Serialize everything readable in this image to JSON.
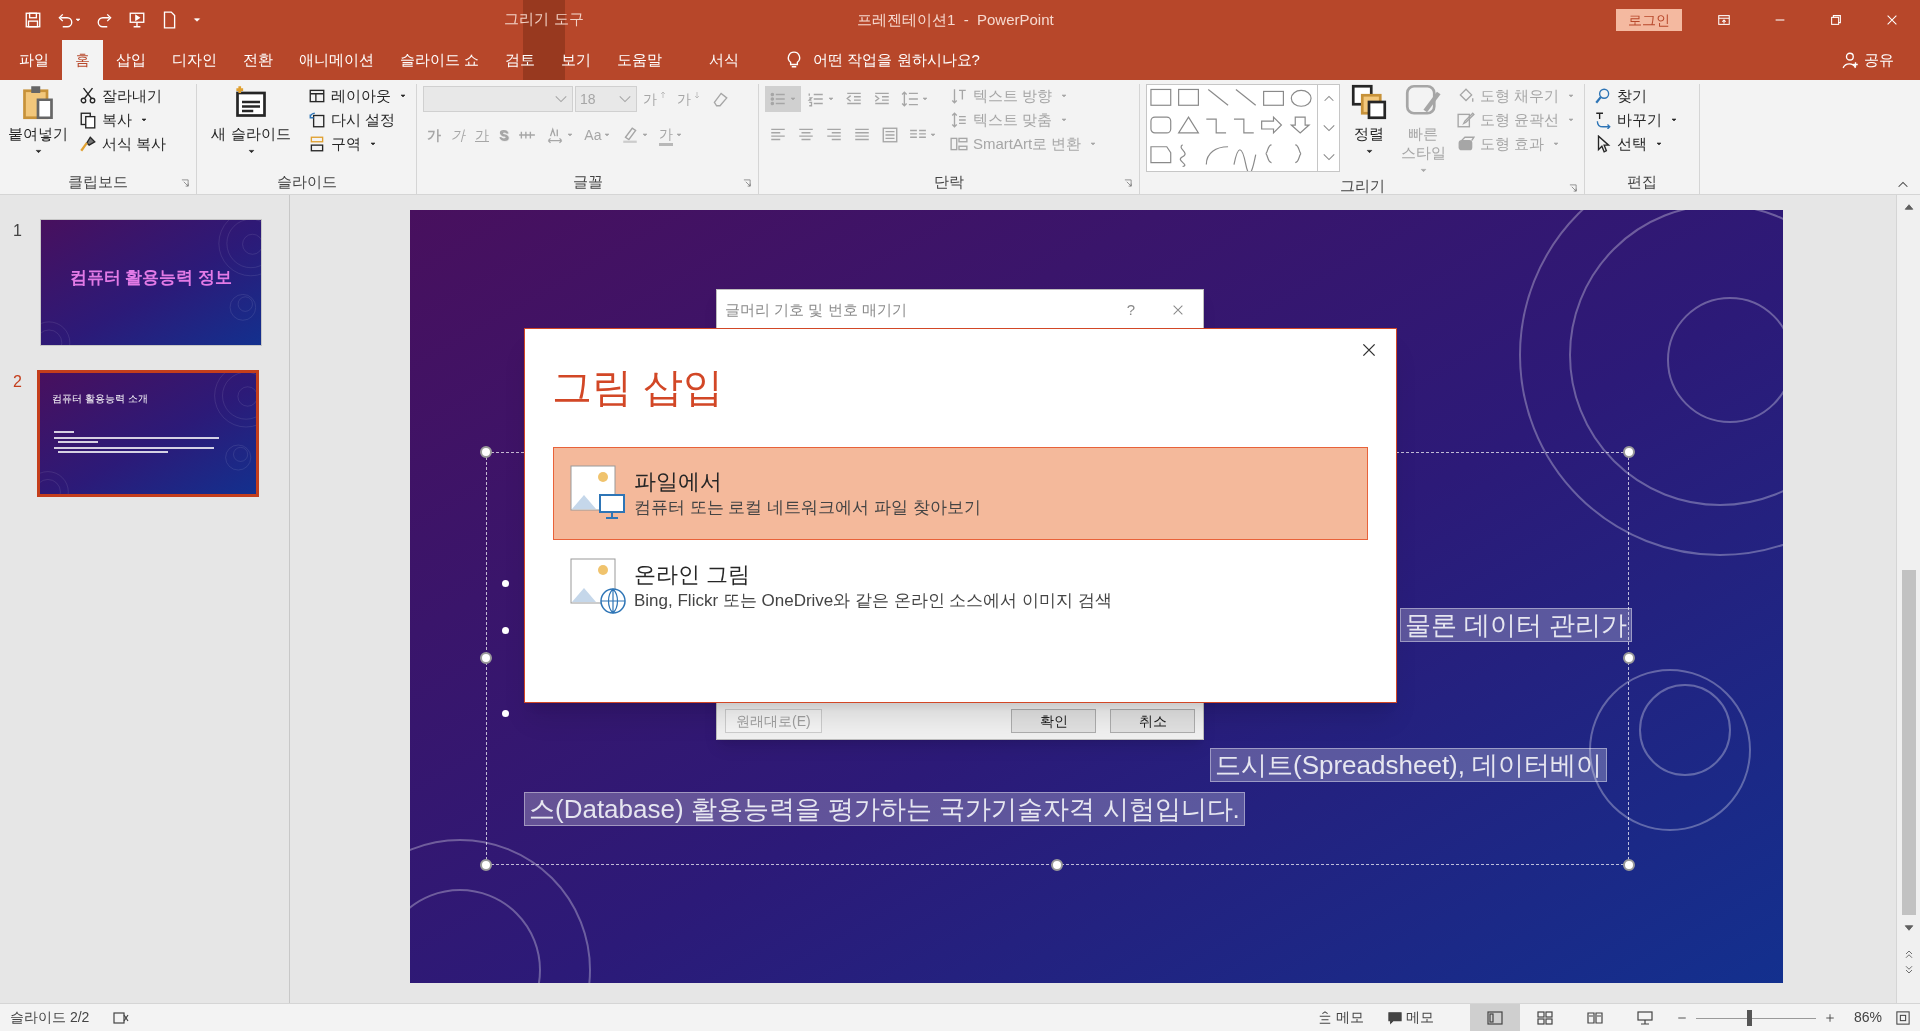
{
  "title_bar": {
    "contextual_group": "그리기 도구",
    "title": "프레젠테이션1  -  PowerPoint",
    "login_button": "로그인"
  },
  "tabs": [
    {
      "label": "파일",
      "kind": "normal",
      "selected": false
    },
    {
      "label": "홈",
      "kind": "normal",
      "selected": true
    },
    {
      "label": "삽입",
      "kind": "normal",
      "selected": false
    },
    {
      "label": "디자인",
      "kind": "normal",
      "selected": false
    },
    {
      "label": "전환",
      "kind": "normal",
      "selected": false
    },
    {
      "label": "애니메이션",
      "kind": "normal",
      "selected": false
    },
    {
      "label": "슬라이드 쇼",
      "kind": "normal",
      "selected": false
    },
    {
      "label": "검토",
      "kind": "normal",
      "selected": false
    },
    {
      "label": "보기",
      "kind": "normal",
      "selected": false
    },
    {
      "label": "도움말",
      "kind": "normal",
      "selected": false
    },
    {
      "label": "서식",
      "kind": "contextual",
      "selected": false
    }
  ],
  "tell_me": "어떤 작업을 원하시나요?",
  "share_button": "공유",
  "ribbon_groups": [
    {
      "label": "클립보드",
      "launcher": true,
      "items": [
        {
          "kind": "large",
          "label": "붙여넣기",
          "dropdown": true,
          "disabled": false
        },
        {
          "kind": "small",
          "label": "잘라내기",
          "disabled": false
        },
        {
          "kind": "small",
          "label": "복사",
          "dropdown": true,
          "disabled": false
        },
        {
          "kind": "small",
          "label": "서식 복사",
          "disabled": false
        }
      ]
    },
    {
      "label": "슬라이드",
      "items": [
        {
          "kind": "large",
          "label": "새 슬라이드",
          "dropdown": true,
          "disabled": false
        },
        {
          "kind": "small",
          "label": "레이아웃",
          "dropdown": true,
          "disabled": false
        },
        {
          "kind": "small",
          "label": "다시 설정",
          "disabled": false
        },
        {
          "kind": "small",
          "label": "구역",
          "dropdown": true,
          "disabled": false
        }
      ]
    },
    {
      "label": "글꼴",
      "launcher": true,
      "controls": [
        {
          "kind": "field",
          "disabled": true
        },
        {
          "kind": "field",
          "value": "18",
          "disabled": true
        },
        {
          "kind": "glyph",
          "label": "가",
          "disabled": true
        },
        {
          "kind": "glyph",
          "label": "가",
          "disabled": true
        },
        {
          "kind": "icon",
          "disabled": true
        },
        {
          "kind": "glyph",
          "label": "가",
          "disabled": true
        },
        {
          "kind": "glyph",
          "label": "가",
          "disabled": true
        },
        {
          "kind": "glyph",
          "label": "가",
          "disabled": true
        },
        {
          "kind": "glyph",
          "label": "S",
          "disabled": true
        },
        {
          "kind": "icon",
          "disabled": true
        },
        {
          "kind": "icon",
          "dropdown": true,
          "disabled": true
        },
        {
          "kind": "glyph",
          "label": "Aa",
          "dropdown": true,
          "disabled": true
        },
        {
          "kind": "icon",
          "dropdown": true,
          "disabled": true
        },
        {
          "kind": "glyph",
          "label": "가",
          "dropdown": true,
          "disabled": true
        }
      ]
    },
    {
      "label": "단락",
      "launcher": true,
      "controls": [
        {
          "kind": "icon",
          "selected": true,
          "dropdown": true,
          "disabled": true
        },
        {
          "kind": "icon",
          "selected": false,
          "dropdown": true,
          "disabled": true
        },
        {
          "kind": "icon",
          "selected": false,
          "disabled": true
        },
        {
          "kind": "icon",
          "selected": false,
          "disabled": true
        },
        {
          "kind": "icon",
          "selected": false,
          "dropdown": true,
          "disabled": true
        },
        {
          "kind": "icon",
          "selected": false,
          "disabled": true
        },
        {
          "kind": "icon",
          "selected": false,
          "disabled": true
        },
        {
          "kind": "icon",
          "selected": false,
          "disabled": true
        },
        {
          "kind": "icon",
          "selected": false,
          "disabled": true
        },
        {
          "kind": "icon",
          "selected": false,
          "disabled": true
        },
        {
          "kind": "icon",
          "selected": false,
          "dropdown": true,
          "disabled": true
        }
      ],
      "items": [
        {
          "kind": "small",
          "label": "텍스트 방향",
          "dropdown": true,
          "disabled": true
        },
        {
          "kind": "small",
          "label": "텍스트 맞춤",
          "dropdown": true,
          "disabled": true
        },
        {
          "kind": "small",
          "label": "SmartArt로 변환",
          "dropdown": true,
          "disabled": true
        }
      ]
    },
    {
      "label": "그리기",
      "launcher": true,
      "items": [
        {
          "kind": "gallery"
        },
        {
          "kind": "large",
          "label": "정렬",
          "dropdown": true,
          "disabled": false
        },
        {
          "kind": "large",
          "label": "빠른 스타일",
          "dropdown": true,
          "disabled": true
        },
        {
          "kind": "small",
          "label": "도형 채우기",
          "dropdown": true,
          "disabled": true
        },
        {
          "kind": "small",
          "label": "도형 윤곽선",
          "dropdown": true,
          "disabled": true
        },
        {
          "kind": "small",
          "label": "도형 효과",
          "dropdown": true,
          "disabled": true
        }
      ]
    },
    {
      "label": "편집",
      "items": [
        {
          "kind": "small",
          "label": "찾기",
          "disabled": false
        },
        {
          "kind": "small",
          "label": "바꾸기",
          "dropdown": true,
          "disabled": false
        },
        {
          "kind": "small",
          "label": "선택",
          "dropdown": true,
          "disabled": false
        }
      ]
    }
  ],
  "slides": [
    {
      "number": "1",
      "kind": "title_slide",
      "title": "컴퓨터 활용능력 정보",
      "selected": false
    },
    {
      "number": "2",
      "kind": "content_slide",
      "title": "컴퓨터 활용능력 소개",
      "selected": true
    }
  ],
  "slide_text_runs": [
    "물론 데이터 관리가",
    "드시트(Spreadsheet), 데이터베이",
    "스(Database) 활용능력을 평가하는 국가기술자격 시험입니다."
  ],
  "bullets_dialog": {
    "title": "글머리 기호 및 번호 매기기",
    "help": "?",
    "buttons": [
      {
        "label": "원래대로(E)",
        "disabled": true
      },
      {
        "label": "확인",
        "disabled": false
      },
      {
        "label": "취소",
        "disabled": false
      }
    ]
  },
  "insert_picture_dialog": {
    "title": "그림 삽입",
    "options": [
      {
        "kind": "file",
        "title": "파일에서",
        "description": "컴퓨터 또는 로컬 네트워크에서 파일 찾아보기",
        "selected": true
      },
      {
        "kind": "online",
        "title": "온라인 그림",
        "description": "Bing, Flickr 또는 OneDrive와 같은 온라인 소스에서 이미지 검색",
        "selected": false
      }
    ]
  },
  "status_bar": {
    "slide_counter": "슬라이드 2/2",
    "notes_button": "메모",
    "comments_button": "메모",
    "views": [
      {
        "selected": true
      },
      {
        "selected": false
      },
      {
        "selected": false
      },
      {
        "selected": false
      }
    ],
    "zoom_slider": {
      "level": 0.44
    },
    "zoom": "86%"
  }
}
